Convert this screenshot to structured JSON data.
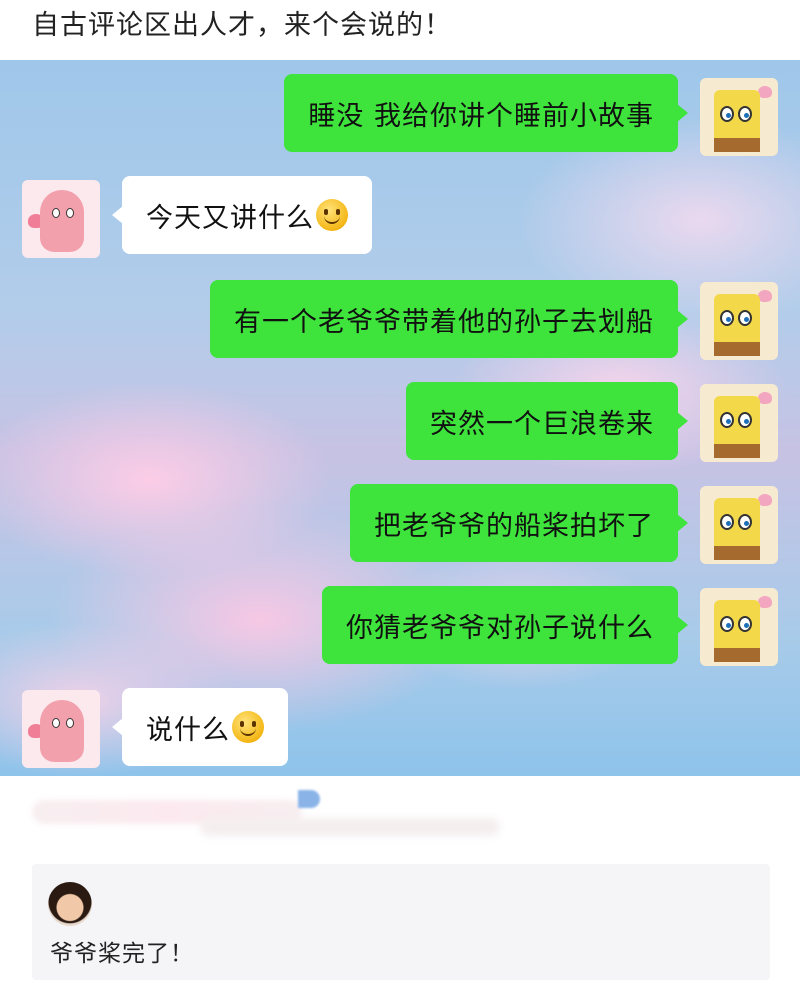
{
  "post": {
    "title": "自古评论区出人才，来个会说的！"
  },
  "chat": {
    "messages": [
      {
        "side": "out",
        "text": "睡没  我给你讲个睡前小故事",
        "emoji": false
      },
      {
        "side": "in",
        "text": "今天又讲什么",
        "emoji": true
      },
      {
        "side": "out",
        "text": "有一个老爷爷带着他的孙子去划船",
        "emoji": false
      },
      {
        "side": "out",
        "text": "突然一个巨浪卷来",
        "emoji": false
      },
      {
        "side": "out",
        "text": "把老爷爷的船桨拍坏了",
        "emoji": false
      },
      {
        "side": "out",
        "text": "你猜老爷爷对孙子说什么",
        "emoji": false
      },
      {
        "side": "in",
        "text": "说什么",
        "emoji": true
      }
    ],
    "colors": {
      "outgoing_bubble": "#3ee33c",
      "incoming_bubble": "#ffffff"
    }
  },
  "comment": {
    "text": "爷爷桨完了！"
  }
}
